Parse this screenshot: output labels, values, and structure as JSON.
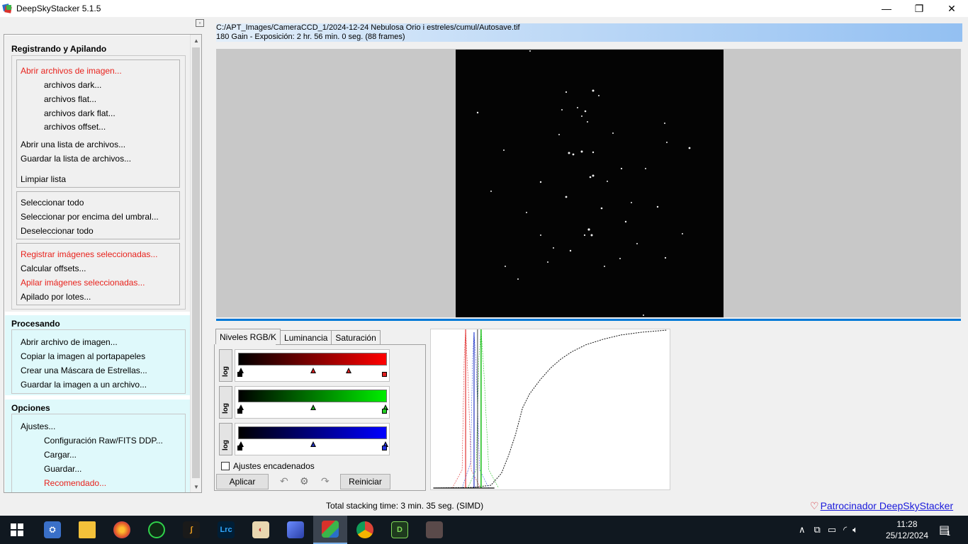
{
  "window": {
    "title": "DeepSkyStacker 5.1.5",
    "minimize": "—",
    "maximize": "❐",
    "close": "✕"
  },
  "left_panel": {
    "section1": {
      "title": "Registrando y Apilando",
      "open_images": "Abrir archivos de imagen...",
      "dark": "archivos dark...",
      "flat": "archivos flat...",
      "dark_flat": "archivos dark flat...",
      "offset": "archivos offset...",
      "open_list": "Abrir una lista de archivos...",
      "save_list": "Guardar la lista de archivos...",
      "clear_list": "Limpiar lista",
      "select_all": "Seleccionar todo",
      "select_threshold": "Seleccionar por encima del umbral...",
      "deselect_all": "Deseleccionar todo",
      "register_selected": "Registrar imágenes seleccionadas...",
      "compute_offsets": "Calcular offsets...",
      "stack_selected": "Apilar imágenes seleccionadas...",
      "batch_stacking": "Apilado por lotes..."
    },
    "section2": {
      "title": "Procesando",
      "open_image": "Abrir archivo de imagen...",
      "copy_clipboard": "Copiar la imagen al portapapeles",
      "star_mask": "Crear una Máscara de Estrellas...",
      "save_image": "Guardar la imagen a un archivo..."
    },
    "section3": {
      "title": "Opciones",
      "settings": "Ajustes...",
      "raw_fits": "Configuración Raw/FITS DDP...",
      "load": "Cargar...",
      "save": "Guardar...",
      "recommended": "Recomendado..."
    }
  },
  "info": {
    "path": "C:/APT_Images/CameraCCD_1/2024-12-24 Nebulosa Orio i estreles/cumul/Autosave.tif",
    "details": "180 Gain - Exposición: 2 hr. 56 min. 0 seg. (88 frames)"
  },
  "tabs": {
    "rgb": "Niveles RGB/K",
    "luminance": "Luminancia",
    "saturation": "Saturación"
  },
  "levels": {
    "log_label": "log",
    "linked_label": "Ajustes encadenados",
    "linked_checked": false,
    "apply_button": "Aplicar",
    "reset_button": "Reiniciar"
  },
  "status": {
    "stacking_time": "Total stacking time: 3 min. 35 seg.  (SIMD)",
    "sponsor": "Patrocinador DeepSkyStacker"
  },
  "taskbar": {
    "apps": [
      "start",
      "network-app",
      "file-explorer",
      "firefox",
      "guiding-app",
      "sharpcap",
      "lightroom",
      "paint",
      "stellarium",
      "deepskystacker",
      "chrome",
      "d-app",
      "game-app"
    ],
    "lightroom_label": "Lrc",
    "time": "11:28",
    "date": "25/12/2024",
    "notification_count": "1"
  },
  "colors": {
    "accent": "#0078d7",
    "red_link": "#e8221c",
    "section_bg": "#dff9fb",
    "sponsor_link": "#1a1adb"
  }
}
